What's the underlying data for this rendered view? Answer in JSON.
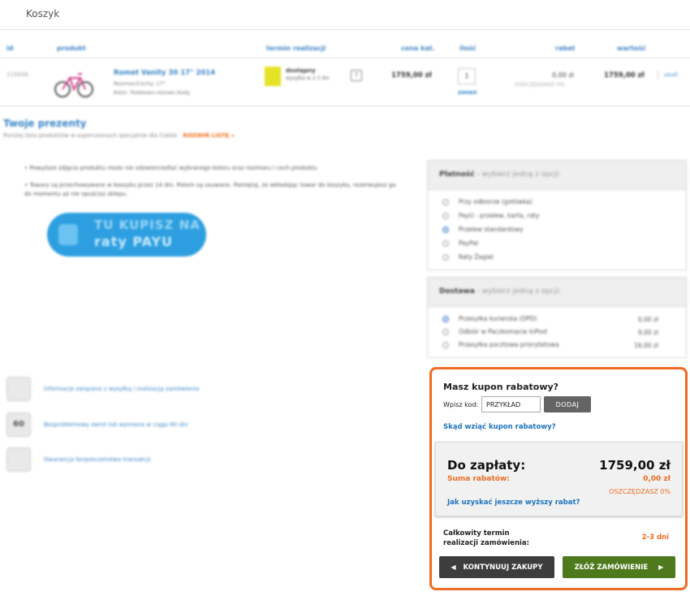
{
  "page": {
    "title": "Koszyk"
  },
  "cart_table": {
    "headers": [
      "id",
      "produkt",
      "termin realizacji",
      "cena kat.",
      "ilość",
      "rabat",
      "wartość"
    ],
    "row": {
      "id": "115939",
      "product_name": "Romet Vanity 30 17\" 2014",
      "product_size": "Rozmiar/Cechy: 17\"",
      "product_color": "Kolor: fioletowo-różowo-biały",
      "availability_title": "dostępny",
      "availability_sub": "wysyłka w 2-3 dni",
      "price": "1759,00 zł",
      "quantity": "1",
      "change_label": "zmień",
      "discount": "0,00 zł",
      "discount_pct": "OSZCZĘDZASZ 0%",
      "value": "1759,00 zł",
      "remove_label": "usuń"
    }
  },
  "gifts": {
    "title": "Twoje prezenty",
    "subtitle": "Poniżej lista produktów w superceenach specjalnie dla Ciebie",
    "expand_link": "ROZWIŃ LISTĘ »"
  },
  "notes": [
    "Powyższe zdjęcia produktu może nie odzwierciedlać wybranego koloru oraz rozmiaru i cech produktu",
    "Towary są przechowywane w koszyku przez 14 dni. Potem są usuwane. Pamiętaj, że wkładając towar do koszyka, rezerwujesz go do momentu aż nie opuścisz sklepu."
  ],
  "raty_banner": {
    "line1": "TU KUPISZ NA",
    "line2": "raty PAYU"
  },
  "payment": {
    "title": "Płatność",
    "subtitle": "- wybierz jedną z opcji:",
    "options": [
      {
        "label": "Przy odbiorze (gotówka)",
        "selected": false
      },
      {
        "label": "PayU - przelew, karta, raty",
        "selected": false
      },
      {
        "label": "Przelew standardowy",
        "selected": true
      },
      {
        "label": "PayPal",
        "selected": false
      },
      {
        "label": "Raty Żagiel",
        "selected": false
      }
    ]
  },
  "delivery": {
    "title": "Dostawa",
    "subtitle": "- wybierz jedną z opcji:",
    "options": [
      {
        "label": "Przesyłka kurierska (DPD)",
        "price": "0,00 zł",
        "selected": true
      },
      {
        "label": "Odbiór w Paczkomacie InPost",
        "price": "9,00 zł",
        "selected": false
      },
      {
        "label": "Przesyłka pocztowa priorytetowa",
        "price": "16,00 zł",
        "selected": false
      }
    ]
  },
  "info_links": [
    {
      "icon": "shipping-icon",
      "label": "Informacje związane z wysyłką i realizacją zamówienia"
    },
    {
      "icon": "return-icon",
      "label": "Bezproblemowy zwrot lub wymiana w ciągu 60 dni"
    },
    {
      "icon": "shield-icon",
      "label": "Gwarancja bezpieczeństwa transakcji"
    }
  ],
  "checkout": {
    "coupon_title": "Masz kupon rabatowy?",
    "code_label": "Wpisz kod:",
    "code_value": "PRZYKŁAD",
    "add_button": "DODAJ",
    "coupon_link": "Skąd wziąć kupon rabatowy?",
    "to_pay_label": "Do zapłaty:",
    "to_pay_value": "1759,00 zł",
    "discount_sum_label": "Suma rabatów:",
    "discount_sum_value": "0,00 zł",
    "save_pct": "OSZCZĘDZASZ 0%",
    "higher_discount_link": "Jak uzyskać jeszcze wyższy rabat?",
    "term_label_1": "Całkowity termin",
    "term_label_2": "realizacji zamówienia:",
    "term_value": "2-3 dni",
    "continue_button": "KONTYNUUJ ZAKUPY",
    "order_button": "ZŁÓŻ ZAMÓWIENIE"
  },
  "colors": {
    "accent_orange": "#ee6c23",
    "link_blue": "#1e73be",
    "order_green": "#4e7a1d",
    "continue_dark": "#3d3d3d"
  }
}
